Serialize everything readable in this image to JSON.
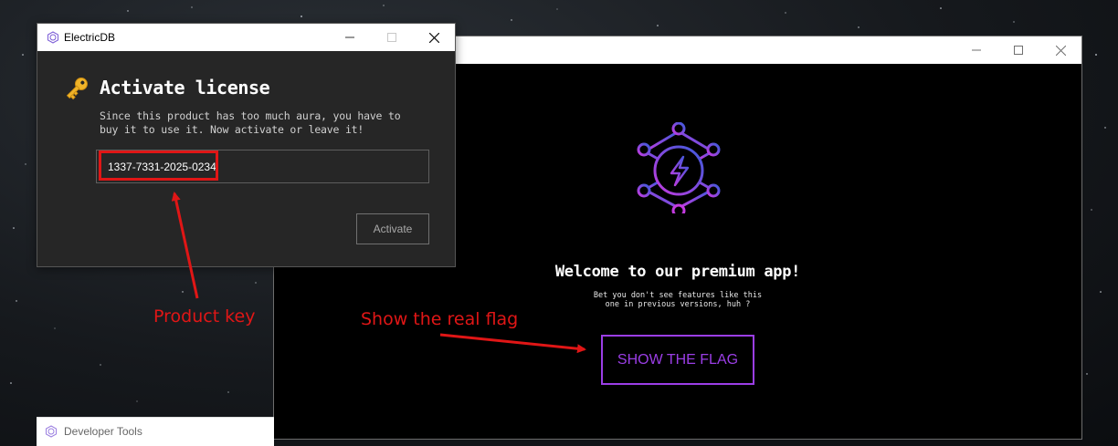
{
  "license_window": {
    "title": "ElectricDB",
    "heading": "Activate license",
    "description": "Since this product has too much aura, you have to buy it to use it. Now activate or leave it!",
    "input_value": "1337-7331-2025-0234",
    "activate_label": "Activate"
  },
  "main_window": {
    "welcome_title": "Welcome to our premium app!",
    "welcome_subtitle_line1": "Bet you don't see features like this",
    "welcome_subtitle_line2": "one in previous versions, huh ?",
    "flag_button_label": "SHOW THE FLAG"
  },
  "devtools": {
    "label": "Developer Tools"
  },
  "annotations": {
    "product_key": "Product key",
    "show_flag": "Show the real flag"
  },
  "icons": {
    "window_controls": [
      "minimize-icon",
      "maximize-icon",
      "close-icon"
    ],
    "logo": "electric-network-logo-icon",
    "key": "key-icon"
  },
  "colors": {
    "accent_purple": "#9b3ee6",
    "annotation_red": "#e01616",
    "logo_blue": "#3b5bdb",
    "logo_magenta": "#c43be0"
  }
}
